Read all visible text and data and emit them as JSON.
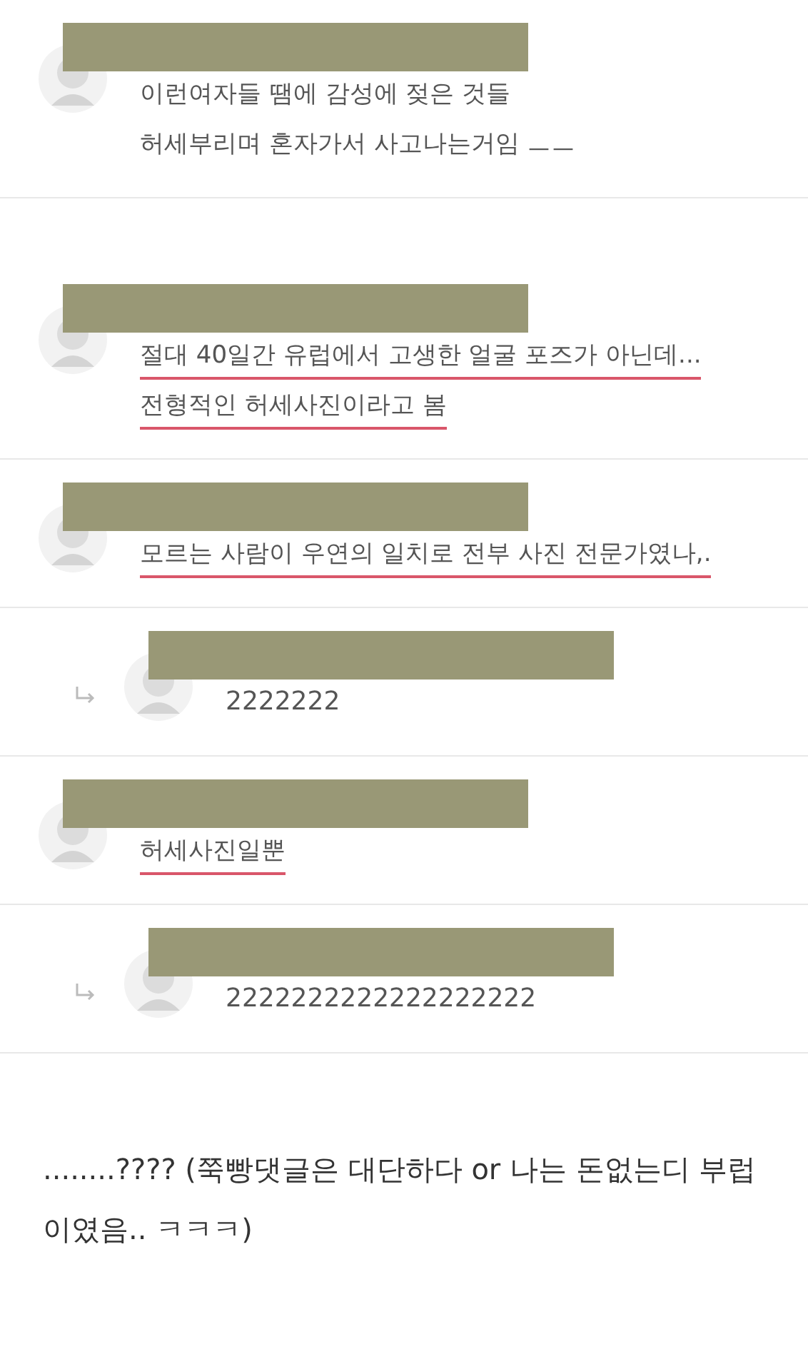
{
  "comments": [
    {
      "kind": "comment",
      "underlined": false,
      "lines": [
        "이런여자들 땜에 감성에 젖은 것들",
        "허세부리며 혼자가서 사고나는거임 ㅡㅡ"
      ]
    },
    {
      "kind": "comment",
      "underlined": true,
      "lines": [
        "절대 40일간 유럽에서 고생한 얼굴 포즈가 아닌데...",
        "전형적인 허세사진이라고 봄"
      ]
    },
    {
      "kind": "comment",
      "underlined": true,
      "lines": [
        "모르는 사람이 우연의 일치로 전부 사진 전문가였나,."
      ]
    },
    {
      "kind": "reply",
      "underlined": false,
      "lines": [
        "2222222"
      ]
    },
    {
      "kind": "comment",
      "underlined": true,
      "lines": [
        "허세사진일뿐"
      ]
    },
    {
      "kind": "reply",
      "underlined": false,
      "lines": [
        "2222222222222222222"
      ]
    }
  ],
  "caption": "........???? (쭉빵댓글은 대단하다 or 나는 돈없는디 부럽 이였음.. ㅋㅋㅋ)"
}
